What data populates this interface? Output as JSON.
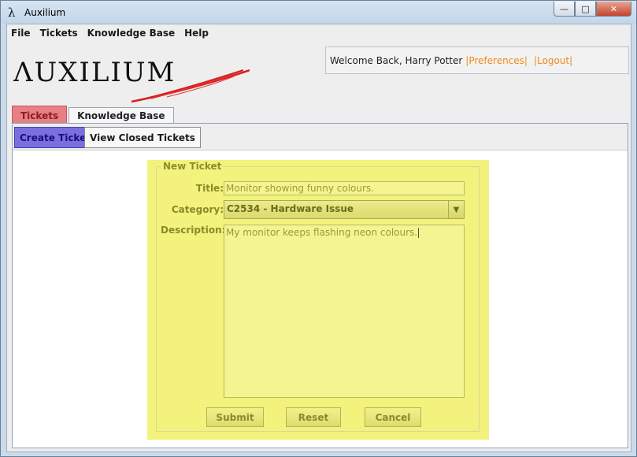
{
  "window": {
    "title": "Auxilium",
    "icon": "lambda-icon"
  },
  "menu": [
    "File",
    "Tickets",
    "Knowledge Base",
    "Help"
  ],
  "header": {
    "logo_text": "Auxilium",
    "welcome": "Welcome Back, Harry Potter",
    "preferences_link": "|Preferences|",
    "logout_link": "|Logout|"
  },
  "tabs": [
    {
      "label": "Tickets",
      "active": true
    },
    {
      "label": "Knowledge Base",
      "active": false
    }
  ],
  "toolbar": {
    "create_label": "Create Ticket",
    "view_closed_label": "View Closed Tickets"
  },
  "form": {
    "legend": "New Ticket",
    "title_label": "Title:",
    "title_value": "Monitor showing funny colours.",
    "category_label": "Category:",
    "category_value": "C2534 - Hardware Issue",
    "description_label": "Description:",
    "description_value": "My monitor keeps flashing neon colours.",
    "submit_label": "Submit",
    "reset_label": "Reset",
    "cancel_label": "Cancel"
  },
  "colors": {
    "active_tab": "#e77f86",
    "active_toolbar_button": "#7b6fe0",
    "form_highlight": "#f2f27c",
    "link": "#f08a1c"
  }
}
